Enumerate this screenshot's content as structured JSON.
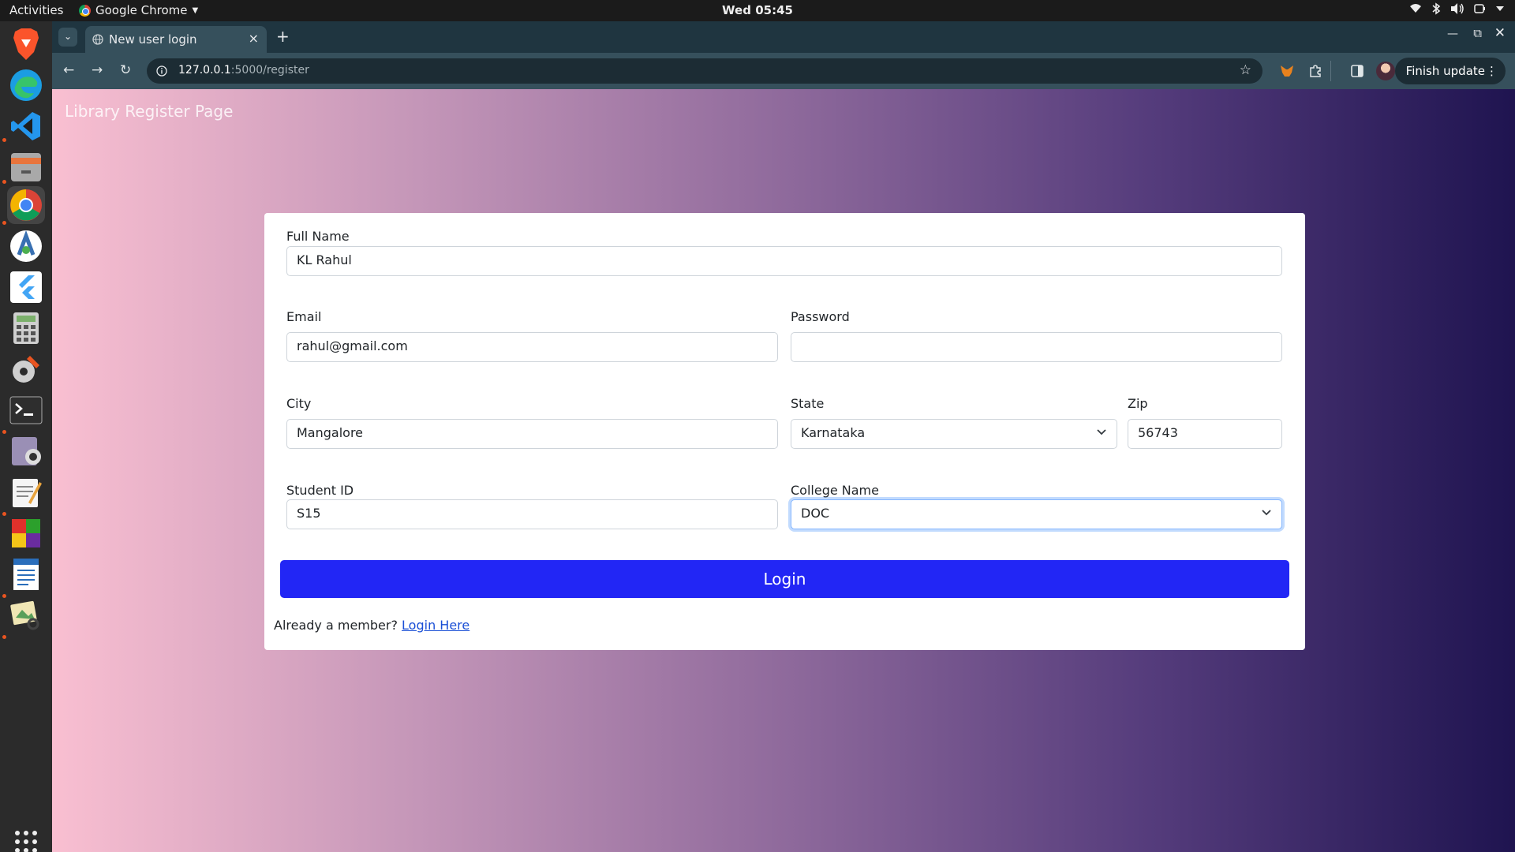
{
  "topbar": {
    "activities": "Activities",
    "app_name": "Google Chrome",
    "clock": "Wed 05:45"
  },
  "dock": {
    "items": [
      "brave-browser",
      "microsoft-edge",
      "vscode",
      "file-manager",
      "google-chrome",
      "android-studio",
      "flutter",
      "calculator",
      "settings-tools",
      "terminal",
      "screenshot-tool",
      "text-editor",
      "color-app",
      "libreoffice-writer",
      "image-viewer",
      "show-apps"
    ]
  },
  "browser": {
    "tab_title": "New user login",
    "url_host": "127.0.0.1",
    "url_path": ":5000/register",
    "finish_update": "Finish update"
  },
  "page": {
    "brand": "Library Register Page",
    "form": {
      "full_name_label": "Full Name",
      "full_name_value": "KL Rahul",
      "email_label": "Email",
      "email_value": "rahul@gmail.com",
      "password_label": "Password",
      "password_value": "",
      "city_label": "City",
      "city_value": "Mangalore",
      "state_label": "State",
      "state_value": "Karnataka",
      "zip_label": "Zip",
      "zip_value": "56743",
      "student_id_label": "Student ID",
      "student_id_value": "S15",
      "college_label": "College Name",
      "college_value": "DOC",
      "submit_label": "Login",
      "member_text": "Already a member?",
      "member_link": "Login Here"
    }
  },
  "colors": {
    "primary_button": "#2226f5",
    "link": "#1a4fd6",
    "gradient_start": "#f9bfd1",
    "gradient_end": "#1f1450"
  }
}
